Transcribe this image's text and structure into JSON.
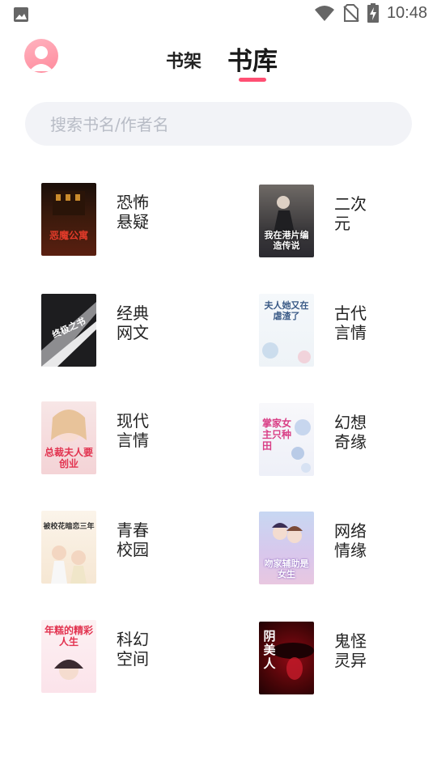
{
  "status_bar": {
    "time": "10:48"
  },
  "header": {
    "tabs": [
      {
        "label": "书架",
        "active": false
      },
      {
        "label": "书库",
        "active": true
      }
    ],
    "accent_color": "#ff4f73"
  },
  "search": {
    "placeholder": "搜索书名/作者名"
  },
  "categories": [
    {
      "label": "恐怖悬疑",
      "cover_text": "恶魔公寓"
    },
    {
      "label": "二次元",
      "cover_text": "我在港片编造传说"
    },
    {
      "label": "经典网文",
      "cover_text": "终极之书"
    },
    {
      "label": "古代言情",
      "cover_text": "夫人她又在虐渣了"
    },
    {
      "label": "现代言情",
      "cover_text": "总裁夫人要创业"
    },
    {
      "label": "幻想奇缘",
      "cover_text": "掌家女主只种田"
    },
    {
      "label": "青春校园",
      "cover_text": "被校花暗恋三年"
    },
    {
      "label": "网络情缘",
      "cover_text": "吻家辅助是女生"
    },
    {
      "label": "科幻空间",
      "cover_text": "年糕的精彩人生"
    },
    {
      "label": "鬼怪灵异",
      "cover_text": "阴美人"
    }
  ]
}
